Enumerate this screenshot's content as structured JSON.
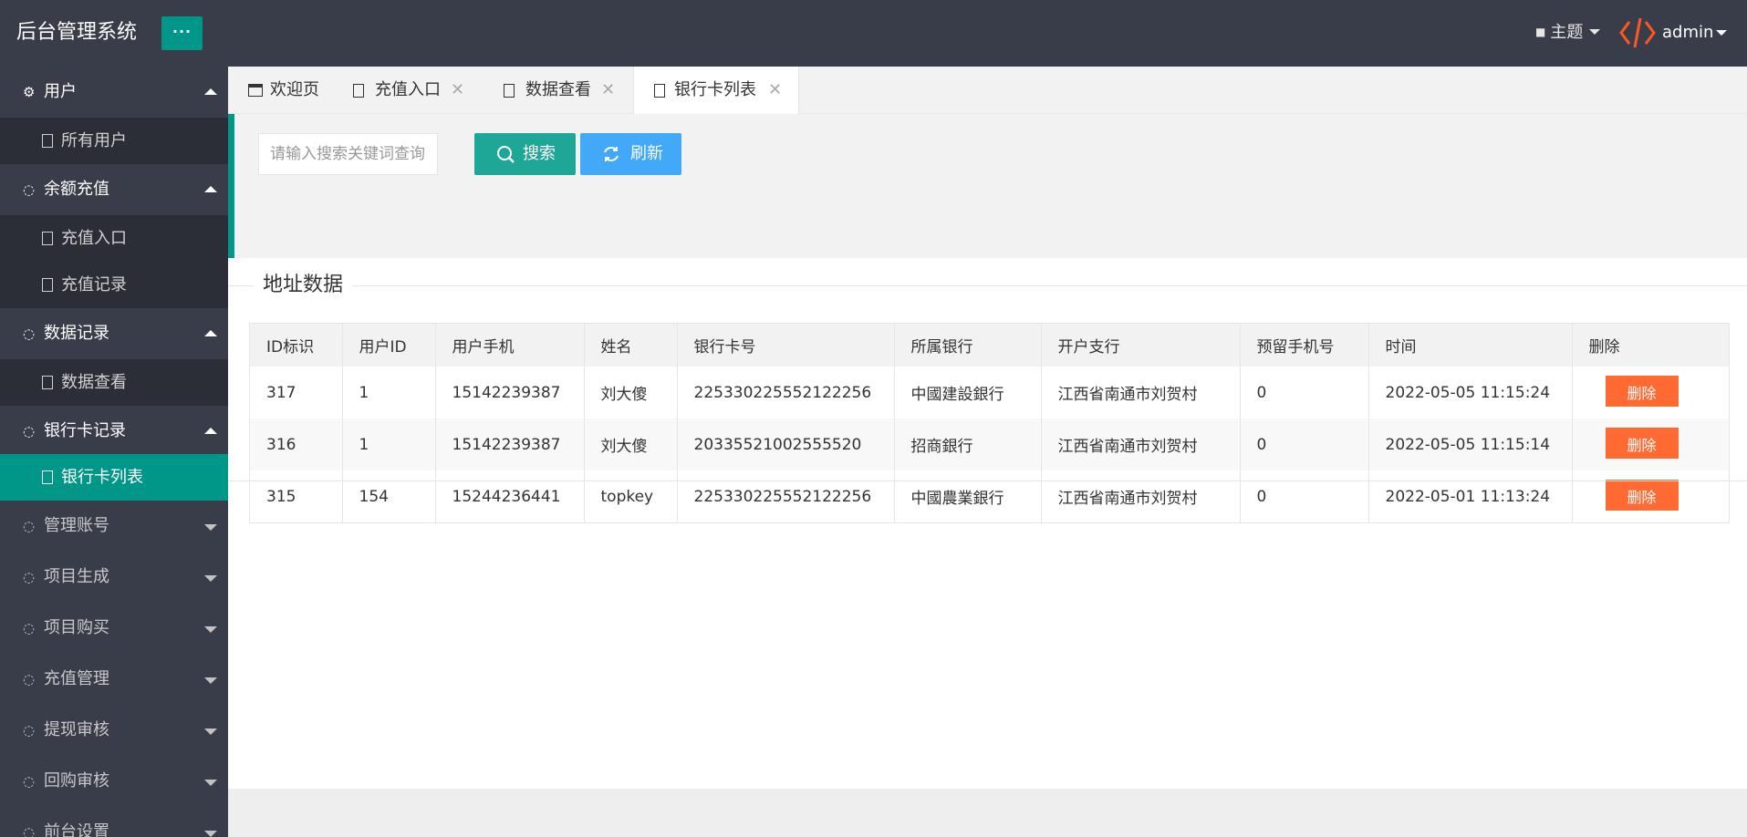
{
  "app": {
    "title": "后台管理系统",
    "menu_button": "···"
  },
  "header": {
    "theme_label": "主题",
    "user_label": "admin"
  },
  "sidebar": {
    "groups": [
      {
        "label": "用户",
        "expanded": true,
        "items": [
          "所有用户"
        ]
      },
      {
        "label": "余额充值",
        "expanded": true,
        "items": [
          "充值入口",
          "充值记录"
        ]
      },
      {
        "label": "数据记录",
        "expanded": true,
        "items": [
          "数据查看"
        ]
      },
      {
        "label": "银行卡记录",
        "expanded": true,
        "items": [
          "银行卡列表"
        ]
      },
      {
        "label": "管理账号",
        "expanded": false
      },
      {
        "label": "项目生成",
        "expanded": false
      },
      {
        "label": "项目购买",
        "expanded": false
      },
      {
        "label": "充值管理",
        "expanded": false
      },
      {
        "label": "提现审核",
        "expanded": false
      },
      {
        "label": "回购审核",
        "expanded": false
      },
      {
        "label": "前台设置",
        "expanded": false
      }
    ],
    "active_item": "银行卡列表"
  },
  "tabs": [
    {
      "label": "欢迎页",
      "closable": false
    },
    {
      "label": "充值入口",
      "closable": true
    },
    {
      "label": "数据查看",
      "closable": true
    },
    {
      "label": "银行卡列表",
      "closable": true,
      "active": true
    }
  ],
  "toolbar": {
    "search_placeholder": "请输入搜索关键词查询",
    "search_button": "搜索",
    "refresh_button": "刷新"
  },
  "section_title": "地址数据",
  "table": {
    "columns": [
      "ID标识",
      "用户ID",
      "用户手机",
      "姓名",
      "银行卡号",
      "所属银行",
      "开户支行",
      "预留手机号",
      "时间",
      "删除"
    ],
    "rows": [
      [
        "317",
        "1",
        "15142239387",
        "刘大傻",
        "225330225552122256",
        "中國建設銀行",
        "江西省南通市刘贺村",
        "0",
        "2022-05-05 11:15:24"
      ],
      [
        "316",
        "1",
        "15142239387",
        "刘大傻",
        "20335521002555520",
        "招商銀行",
        "江西省南通市刘贺村",
        "0",
        "2022-05-05 11:15:14"
      ],
      [
        "315",
        "154",
        "15244236441",
        "topkey",
        "225330225552122256",
        "中國農業銀行",
        "江西省南通市刘贺村",
        "0",
        "2022-05-01 11:13:24"
      ]
    ],
    "delete_label": "删除"
  },
  "colors": {
    "header_bg": "#393d49",
    "accent": "#009688",
    "refresh": "#41a9f7",
    "delete": "#ff6a33"
  }
}
